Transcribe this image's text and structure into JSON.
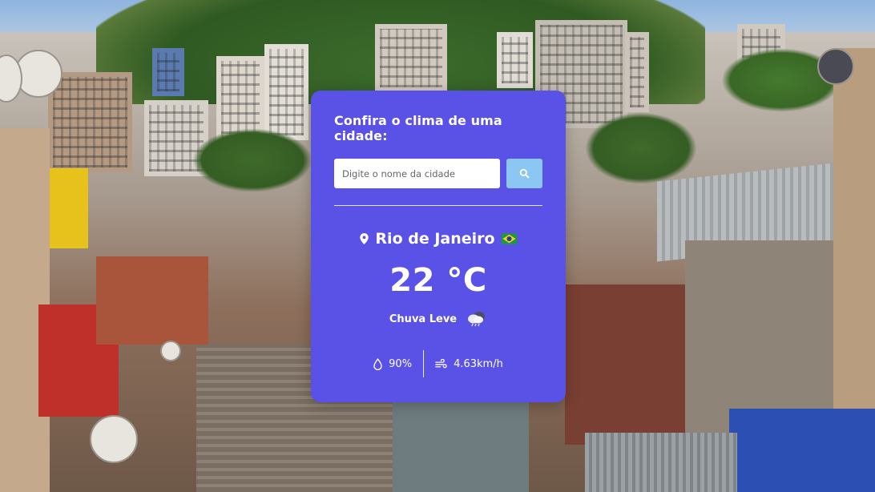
{
  "form": {
    "title": "Confira o clima de uma cidade:",
    "placeholder": "Digite o nome da cidade",
    "search_icon": "search-icon"
  },
  "weather": {
    "city": "Rio de Janeiro",
    "country_flag": "brazil-flag-icon",
    "temperature": "22",
    "unit": "°C",
    "description": "Chuva Leve",
    "weather_icon": "rain-cloud-icon",
    "humidity": "90%",
    "wind": "4.63km/h"
  },
  "colors": {
    "card": "#5a51e6",
    "button": "#8cc7f4"
  }
}
